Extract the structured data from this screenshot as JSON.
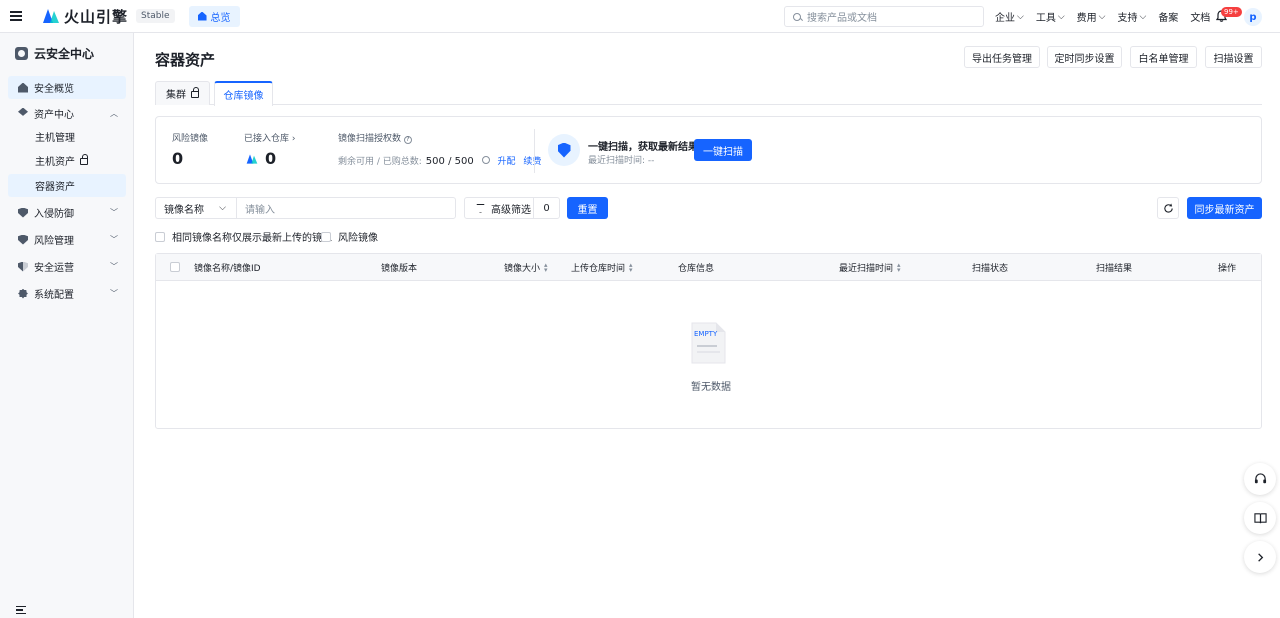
{
  "topbar": {
    "brand": "火山引擎",
    "env_tag": "Stable",
    "home_tab": "总览",
    "search_placeholder": "搜索产品或文档",
    "links": [
      "企业",
      "工具",
      "费用",
      "支持",
      "备案",
      "文档"
    ],
    "notification_badge": "99+",
    "avatar_letter": "p"
  },
  "sidebar": {
    "title": "云安全中心",
    "items": [
      {
        "label": "安全概览"
      },
      {
        "label": "资产中心"
      },
      {
        "label": "主机管理"
      },
      {
        "label": "主机资产"
      },
      {
        "label": "容器资产"
      },
      {
        "label": "入侵防御"
      },
      {
        "label": "风险管理"
      },
      {
        "label": "安全运营"
      },
      {
        "label": "系统配置"
      }
    ]
  },
  "page": {
    "title": "容器资产",
    "actions": [
      "导出任务管理",
      "定时同步设置",
      "白名单管理",
      "扫描设置"
    ],
    "tabs": [
      "集群",
      "仓库镜像"
    ]
  },
  "stats": {
    "risk_images_label": "风险镜像",
    "risk_images_value": "0",
    "repos_label": "已接入仓库",
    "repos_value": "0",
    "auth_label": "镜像扫描授权数",
    "auth_remaining_label": "剩余可用 / 已购总数:",
    "auth_value": "500 / 500",
    "upgrade": "升配",
    "renew": "续费",
    "scan_title": "一键扫描，获取最新结果",
    "last_scan_label": "最近扫描时间: --",
    "scan_button": "一键扫描"
  },
  "filters": {
    "field_select": "镜像名称",
    "input_placeholder": "请输入",
    "advanced_label": "高级筛选",
    "advanced_count": "0",
    "reset": "重置",
    "sync": "同步最新资产",
    "checkbox_latest": "相同镜像名称仅展示最新上传的镜像",
    "checkbox_risk": "风险镜像"
  },
  "table": {
    "columns": [
      "镜像名称/镜像ID",
      "镜像版本",
      "镜像大小",
      "上传仓库时间",
      "仓库信息",
      "最近扫描时间",
      "扫描状态",
      "扫描结果",
      "操作"
    ],
    "empty_image_text": "EMPTY",
    "empty_text": "暂无数据"
  },
  "colors": {
    "primary": "#1664ff",
    "primary_light": "#e8f3ff",
    "badge": "#f53f3f"
  }
}
